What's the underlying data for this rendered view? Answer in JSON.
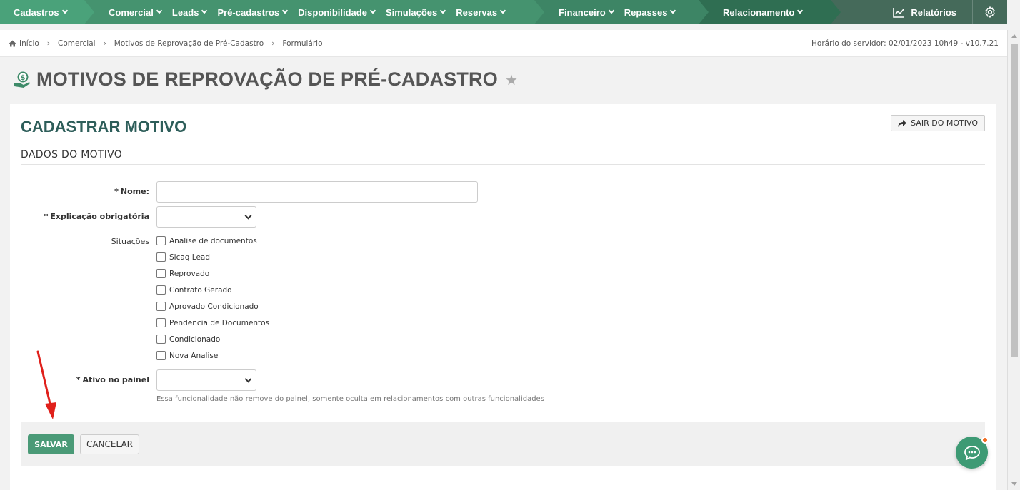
{
  "nav": {
    "cadastros": "Cadastros",
    "comercial_items": [
      "Comercial",
      "Leads",
      "Pré-cadastros",
      "Disponibilidade",
      "Simulações",
      "Reservas"
    ],
    "financeiro_items": [
      "Financeiro",
      "Repasses"
    ],
    "relacionamento": "Relacionamento",
    "relatorios": "Relatórios"
  },
  "breadcrumb": {
    "items": [
      "Início",
      "Comercial",
      "Motivos de Reprovação de Pré-Cadastro",
      "Formulário"
    ],
    "server_time": "Horário do servidor: 02/01/2023 10h49 - v10.7.21"
  },
  "page": {
    "title": "MOTIVOS DE REPROVAÇÃO DE PRÉ-CADASTRO"
  },
  "form": {
    "heading": "CADASTRAR MOTIVO",
    "exit_label": "SAIR DO MOTIVO",
    "section_title": "DADOS DO MOTIVO",
    "nome_label": "Nome:",
    "nome_value": "",
    "explicacao_label": "Explicação obrigatória",
    "situacoes_label": "Situações",
    "situacoes": [
      "Analise de documentos",
      "Sicaq Lead",
      "Reprovado",
      "Contrato Gerado",
      "Aprovado Condicionado",
      "Pendencia de Documentos",
      "Condicionado",
      "Nova Analise"
    ],
    "ativo_label": "Ativo no painel",
    "ativo_hint": "Essa funcionalidade não remove do painel, somente oculta em relacionamentos com outras funcionalidades",
    "save_label": "SALVAR",
    "cancel_label": "CANCELAR",
    "required_mark": "*"
  },
  "colors": {
    "accent": "#4a9a77",
    "heading": "#2e5e5a",
    "annotation_arrow": "#e0201b",
    "chat_badge": "#f26b21"
  }
}
